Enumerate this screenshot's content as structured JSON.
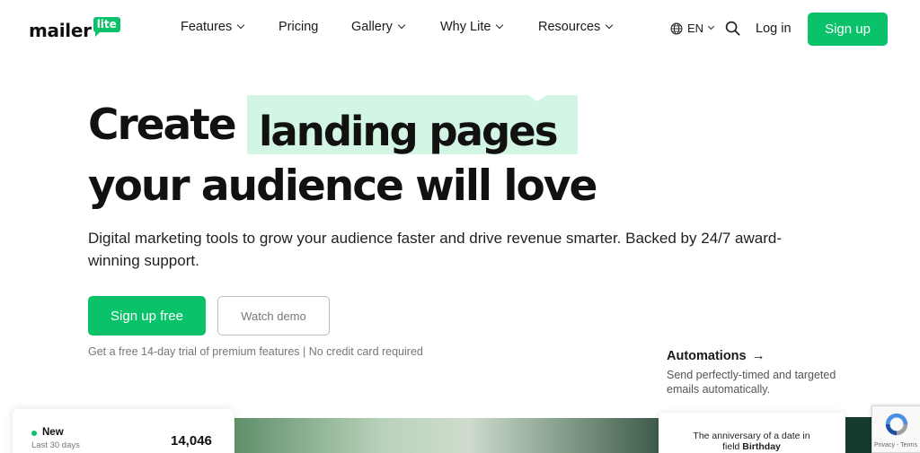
{
  "brand": {
    "name": "mailer",
    "badge": "lite",
    "accent": "#09c269",
    "highlight": "#d3f5e3"
  },
  "nav": {
    "items": [
      {
        "label": "Features",
        "has_dropdown": true
      },
      {
        "label": "Pricing",
        "has_dropdown": false
      },
      {
        "label": "Gallery",
        "has_dropdown": true
      },
      {
        "label": "Why Lite",
        "has_dropdown": true
      },
      {
        "label": "Resources",
        "has_dropdown": true
      }
    ],
    "language": "EN",
    "login": "Log in",
    "signup": "Sign up"
  },
  "hero": {
    "heading_prefix": "Create",
    "heading_highlight": "landing pages",
    "heading_line2": "your audience will love",
    "subtitle": "Digital marketing tools to grow your audience faster and drive revenue smarter. Backed by 24/7 award-winning support.",
    "primary_cta": "Sign up free",
    "secondary_cta": "Watch demo",
    "trial_note": "Get a free 14-day trial of premium features | No credit card required"
  },
  "automations": {
    "title": "Automations",
    "arrow": "→",
    "description": "Send perfectly-timed and targeted emails automatically."
  },
  "stats_card": {
    "label": "New",
    "period": "Last 30 days",
    "value": "14,046"
  },
  "automation_card": {
    "line1": "The anniversary of a date in",
    "line2_prefix": "field",
    "line2_field": "Birthday"
  },
  "recaptcha": {
    "privacy": "Privacy",
    "terms": "Terms",
    "separator": " - "
  },
  "icons": {
    "language": "globe-icon",
    "search": "search-icon",
    "dropdown": "chevron-down-icon",
    "recaptcha": "recaptcha-icon"
  }
}
